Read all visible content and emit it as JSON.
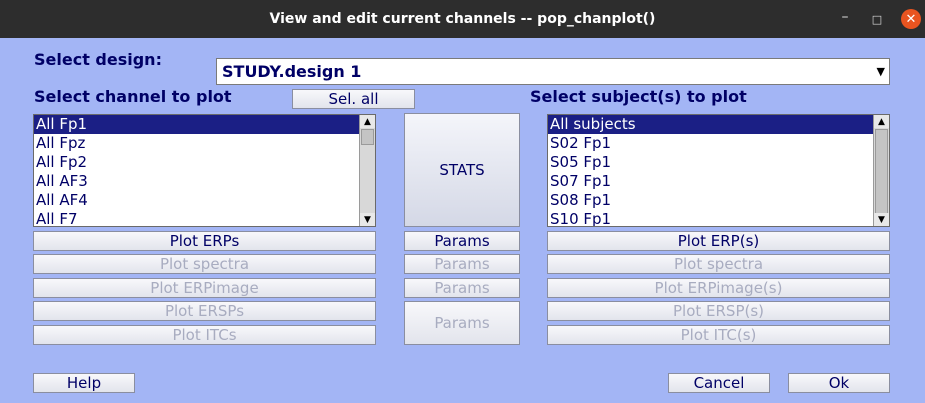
{
  "window": {
    "title": "View and edit current channels -- pop_chanplot()",
    "minimize_glyph": "–",
    "maximize_glyph": "□",
    "close_glyph": "✕"
  },
  "design": {
    "label": "Select design:",
    "selected": "STUDY.design 1"
  },
  "channels": {
    "label": "Select channel to plot",
    "sel_all": "Sel. all",
    "items": [
      "All Fp1",
      "All Fpz",
      "All Fp2",
      "All AF3",
      "All AF4",
      "All F7"
    ]
  },
  "subjects": {
    "label": "Select subject(s) to plot",
    "items": [
      "All subjects",
      "S02 Fp1",
      "S05 Fp1",
      "S07 Fp1",
      "S08 Fp1",
      "S10 Fp1"
    ]
  },
  "stats_button": "STATS",
  "channel_plots": [
    "Plot ERPs",
    "Plot spectra",
    "Plot ERPimage",
    "Plot ERSPs",
    "Plot ITCs"
  ],
  "params": [
    "Params",
    "Params",
    "Params",
    "Params"
  ],
  "subject_plots": [
    "Plot ERP(s)",
    "Plot spectra",
    "Plot ERPimage(s)",
    "Plot ERSP(s)",
    "Plot ITC(s)"
  ],
  "footer": {
    "help": "Help",
    "cancel": "Cancel",
    "ok": "Ok"
  },
  "colors": {
    "background": "#a3b5f5",
    "text": "#000066",
    "selection": "#1b1f85",
    "disabled_text": "#a8acc0",
    "close_button": "#e95420"
  },
  "icons": {
    "dropdown": "chevron-down-icon",
    "scroll_up": "arrow-up-icon",
    "scroll_down": "arrow-down-icon"
  }
}
